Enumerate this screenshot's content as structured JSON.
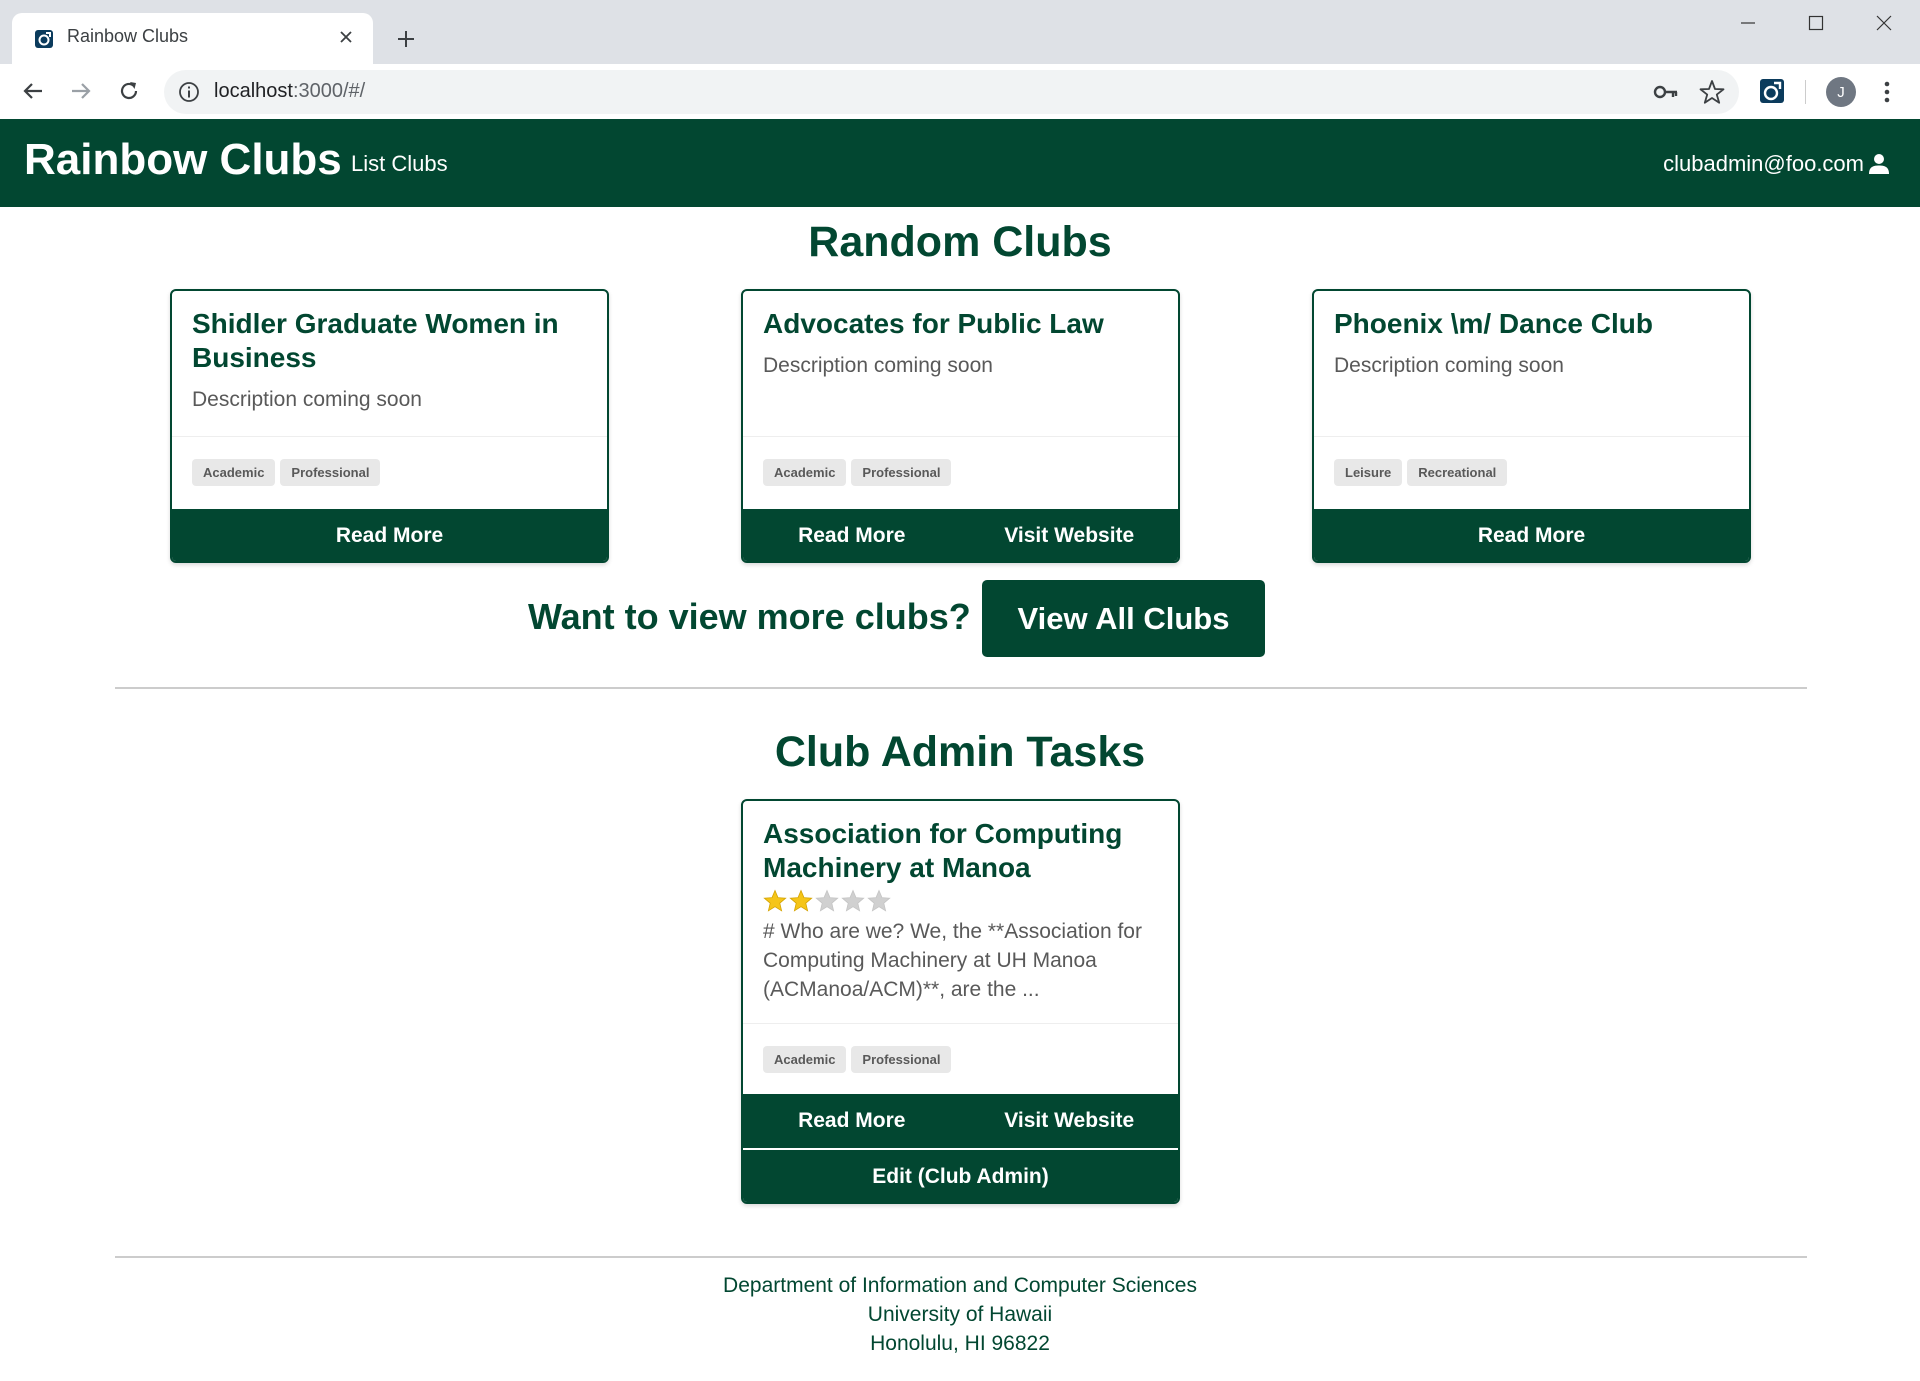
{
  "browser": {
    "tab_title": "Rainbow Clubs",
    "url_host": "localhost",
    "url_rest": ":3000/#/",
    "profile_initial": "J"
  },
  "navbar": {
    "brand": "Rainbow Clubs",
    "list_clubs": "List Clubs",
    "user_email": "clubadmin@foo.com"
  },
  "random_clubs": {
    "title": "Random Clubs",
    "cards": [
      {
        "title": "Shidler Graduate Women in Business",
        "description": "Description coming soon",
        "tags": [
          "Academic",
          "Professional"
        ],
        "buttons": [
          "Read More"
        ]
      },
      {
        "title": "Advocates for Public Law",
        "description": "Description coming soon",
        "tags": [
          "Academic",
          "Professional"
        ],
        "buttons": [
          "Read More",
          "Visit Website"
        ]
      },
      {
        "title": "Phoenix \\m/ Dance Club",
        "description": "Description coming soon",
        "tags": [
          "Leisure",
          "Recreational"
        ],
        "buttons": [
          "Read More"
        ]
      }
    ]
  },
  "more_clubs": {
    "prompt": "Want to view more clubs?",
    "button": "View All Clubs"
  },
  "admin_tasks": {
    "title": "Club Admin Tasks",
    "card": {
      "title": "Association for Computing Machinery at Manoa",
      "rating": 2,
      "rating_max": 5,
      "description": "# Who are we? We, the **Association for Computing Machinery at UH Manoa (ACManoa/ACM)**, are the ...",
      "tags": [
        "Academic",
        "Professional"
      ],
      "read_more": "Read More",
      "visit_website": "Visit Website",
      "edit": "Edit (Club Admin)"
    }
  },
  "footer": {
    "line1": "Department of Information and Computer Sciences",
    "line2": "University of Hawaii",
    "line3": "Honolulu, HI 96822"
  },
  "colors": {
    "brand_green": "#024731",
    "star_filled": "#f5c518",
    "star_empty": "#d0d0d0"
  }
}
